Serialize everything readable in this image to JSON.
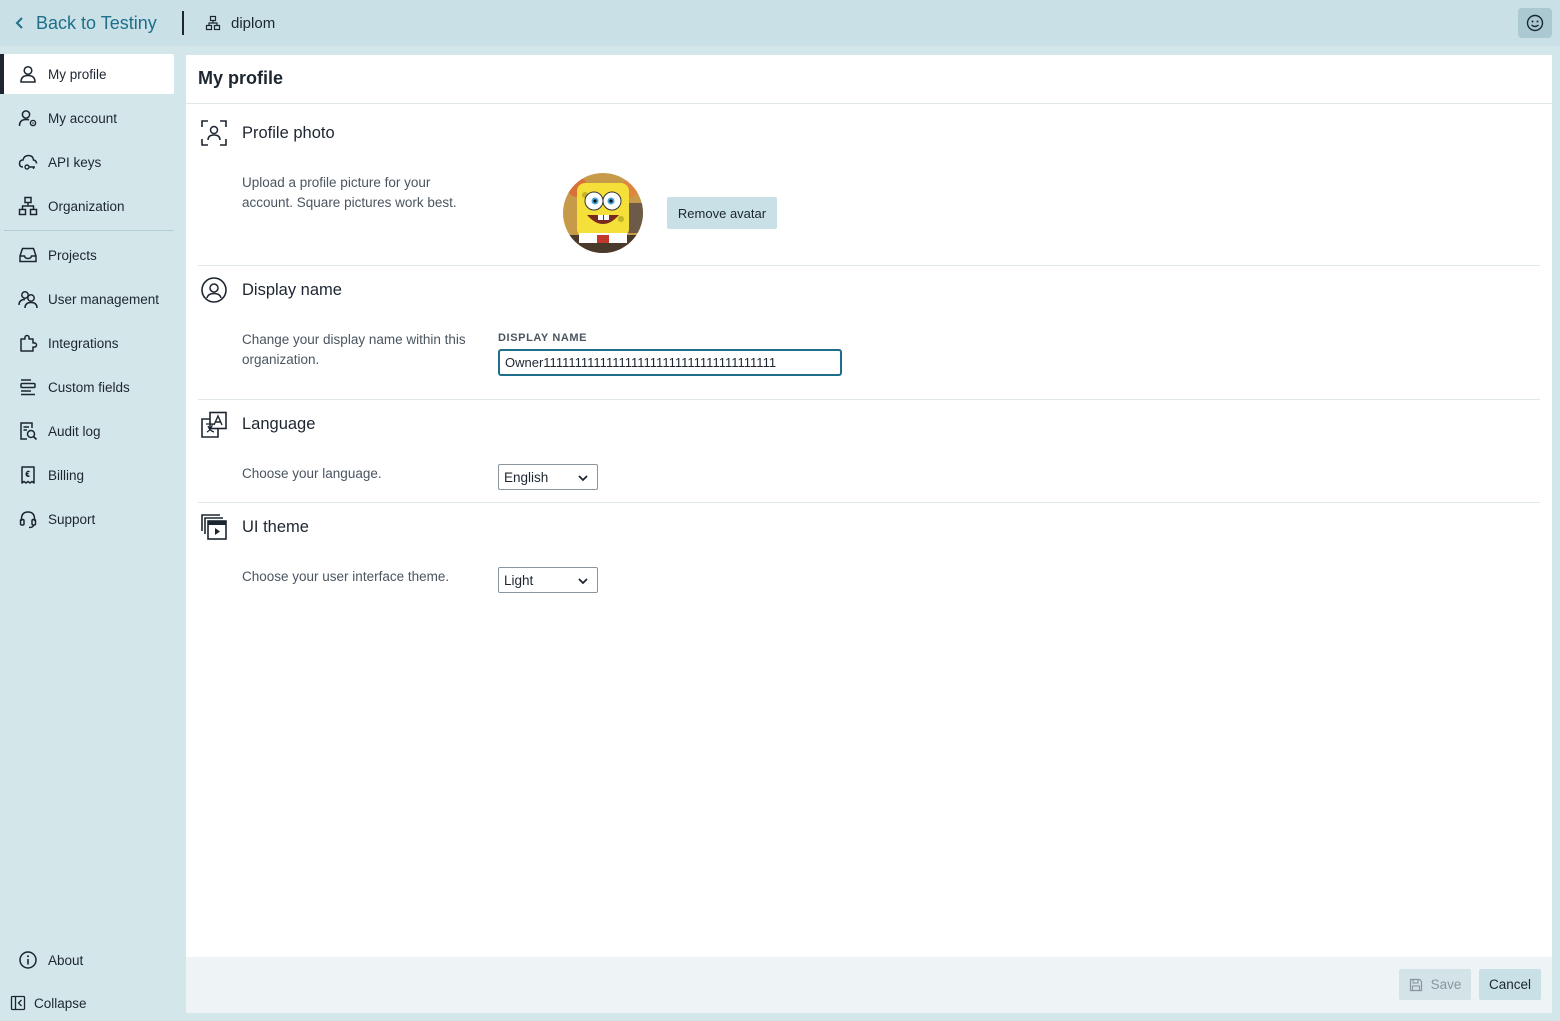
{
  "topbar": {
    "back_label": "Back to Testiny",
    "org_name": "diplom",
    "user_icon": "smiley-face-icon"
  },
  "sidebar": {
    "items": [
      {
        "label": "My profile",
        "icon": "user-icon",
        "active": true
      },
      {
        "label": "My account",
        "icon": "user-settings-icon"
      },
      {
        "label": "API keys",
        "icon": "cloud-key-icon"
      },
      {
        "label": "Organization",
        "icon": "org-tree-icon"
      },
      {
        "label": "Projects",
        "icon": "inbox-icon"
      },
      {
        "label": "User management",
        "icon": "users-icon"
      },
      {
        "label": "Integrations",
        "icon": "puzzle-icon"
      },
      {
        "label": "Custom fields",
        "icon": "fields-icon"
      },
      {
        "label": "Audit log",
        "icon": "audit-search-icon"
      },
      {
        "label": "Billing",
        "icon": "receipt-icon"
      },
      {
        "label": "Support",
        "icon": "headset-icon"
      }
    ],
    "about_label": "About",
    "collapse_label": "Collapse"
  },
  "main": {
    "title": "My profile",
    "sections": {
      "photo": {
        "title": "Profile photo",
        "description": "Upload a profile picture for your account. Square pictures work best.",
        "remove_label": "Remove avatar"
      },
      "display_name": {
        "title": "Display name",
        "description": "Change your display name within this organization.",
        "field_label": "DISPLAY NAME",
        "value": "Owner1111111111111111111111111111111111111"
      },
      "language": {
        "title": "Language",
        "description": "Choose your language.",
        "selected": "English"
      },
      "theme": {
        "title": "UI theme",
        "description": "Choose your user interface theme.",
        "selected": "Light"
      }
    }
  },
  "footer": {
    "save_label": "Save",
    "cancel_label": "Cancel"
  },
  "colors": {
    "accent": "#1f6f8b",
    "sidebar_bg": "#d3e6ea",
    "topbar_bg": "#c8e0e6"
  }
}
